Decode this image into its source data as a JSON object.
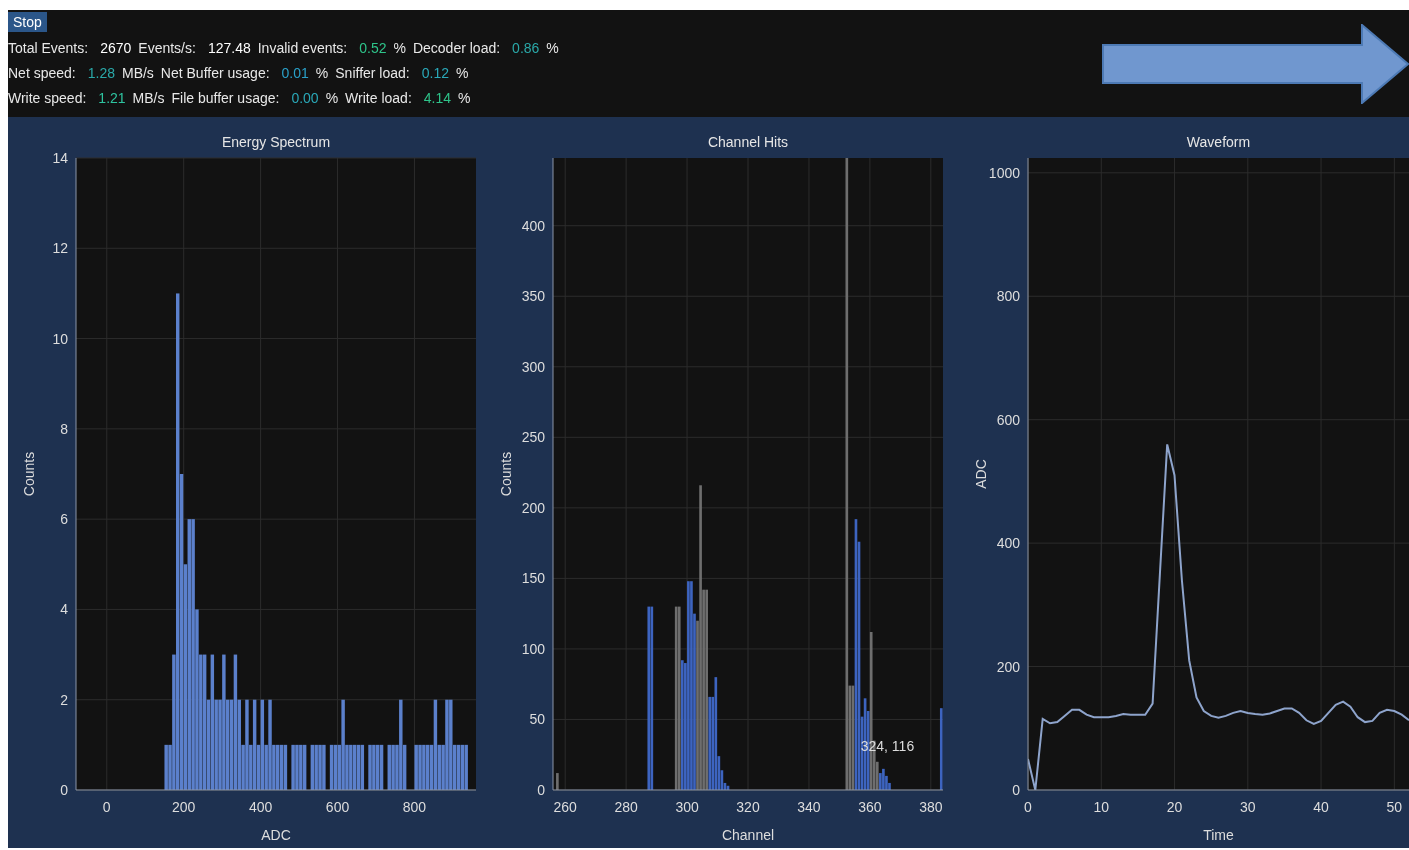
{
  "stop_button": {
    "label": "Stop"
  },
  "stats": [
    [
      {
        "label": "Total Events:",
        "value": "2670",
        "color": "#ffffff"
      },
      {
        "label": "Events/s:",
        "value": "127.48",
        "color": "#ffffff"
      },
      {
        "label": "Invalid events:",
        "value": "0.52",
        "unit": "%",
        "color": "#2ec48a"
      },
      {
        "label": "Decoder load:",
        "value": "0.86",
        "unit": "%",
        "color": "#2aa8a8"
      }
    ],
    [
      {
        "label": "Net speed:",
        "value": "1.28",
        "unit": "MB/s",
        "color": "#2aa8a8"
      },
      {
        "label": "Net Buffer usage:",
        "value": "0.01",
        "unit": "%",
        "color": "#2aa0c8"
      },
      {
        "label": "Sniffer load:",
        "value": "0.12",
        "unit": "%",
        "color": "#2aa8b8"
      }
    ],
    [
      {
        "label": "Write speed:",
        "value": "1.21",
        "unit": "MB/s",
        "color": "#2ec4a0"
      },
      {
        "label": "File buffer usage:",
        "value": "0.00",
        "unit": "%",
        "color": "#2aa8b8"
      },
      {
        "label": "Write load:",
        "value": "4.14",
        "unit": "%",
        "color": "#2ec48a"
      }
    ]
  ],
  "plots": [
    {
      "chart_data": {
        "type": "bar",
        "title": "Energy Spectrum",
        "xlabel": "ADC",
        "ylabel": "Counts",
        "grid": true,
        "xlim": [
          -80,
          960
        ],
        "ylim": [
          0,
          14
        ],
        "xticks": [
          0,
          200,
          400,
          600,
          800
        ],
        "yticks": [
          0,
          2,
          4,
          6,
          8,
          10,
          12,
          14
        ],
        "x": [
          150,
          160,
          170,
          180,
          190,
          200,
          210,
          220,
          230,
          240,
          250,
          260,
          270,
          280,
          290,
          300,
          310,
          320,
          330,
          340,
          350,
          360,
          370,
          380,
          390,
          400,
          410,
          420,
          430,
          440,
          450,
          460,
          470,
          480,
          490,
          500,
          510,
          520,
          530,
          540,
          550,
          560,
          570,
          580,
          590,
          600,
          610,
          620,
          630,
          640,
          650,
          660,
          670,
          680,
          690,
          700,
          710,
          720,
          730,
          740,
          750,
          760,
          770,
          780,
          790,
          800,
          810,
          820,
          830,
          840,
          850,
          860,
          870,
          880,
          890,
          900,
          910,
          920,
          930
        ],
        "series": [
          {
            "color": "#5b80cc",
            "values": [
              1,
              1,
              3,
              11,
              7,
              5,
              6,
              6,
              4,
              3,
              3,
              2,
              3,
              2,
              2,
              3,
              2,
              2,
              3,
              2,
              1,
              2,
              1,
              2,
              1,
              2,
              1,
              2,
              1,
              1,
              1,
              1,
              0,
              1,
              1,
              1,
              1,
              0,
              1,
              1,
              1,
              1,
              0,
              1,
              1,
              1,
              2,
              1,
              1,
              1,
              1,
              1,
              0,
              1,
              1,
              1,
              1,
              0,
              1,
              1,
              1,
              2,
              1,
              0,
              0,
              1,
              1,
              1,
              1,
              1,
              2,
              1,
              1,
              2,
              2,
              1,
              1,
              1,
              1
            ]
          }
        ]
      }
    },
    {
      "chart_data": {
        "type": "bar",
        "title": "Channel Hits",
        "xlabel": "Channel",
        "ylabel": "Counts",
        "grid": true,
        "xlim": [
          256,
          384
        ],
        "ylim": [
          0,
          448
        ],
        "xticks": [
          260,
          280,
          300,
          320,
          340,
          360,
          380
        ],
        "yticks": [
          0,
          50,
          100,
          150,
          200,
          250,
          300,
          350,
          400
        ],
        "x": [
          257,
          287,
          288,
          296,
          297,
          298,
          299,
          300,
          301,
          302,
          303,
          304,
          305,
          306,
          307,
          308,
          309,
          310,
          311,
          312,
          313,
          352,
          353,
          354,
          355,
          356,
          357,
          358,
          359,
          360,
          361,
          362,
          363,
          364,
          365,
          366,
          383
        ],
        "series": [
          {
            "color": "#3d64c0",
            "values": [
              null,
              130,
              130,
              null,
              null,
              92,
              90,
              148,
              148,
              125,
              null,
              null,
              null,
              null,
              66,
              66,
              80,
              24,
              14,
              5,
              3,
              null,
              null,
              null,
              192,
              176,
              52,
              65,
              56,
              null,
              null,
              null,
              12,
              15,
              10,
              5,
              58
            ]
          },
          {
            "color": "#6e6e6e",
            "values": [
              12,
              null,
              null,
              130,
              130,
              null,
              null,
              null,
              null,
              null,
              120,
              216,
              142,
              142,
              null,
              null,
              null,
              null,
              null,
              null,
              null,
              448,
              74,
              74,
              null,
              null,
              null,
              null,
              null,
              112,
              35,
              20,
              null,
              null,
              null,
              null,
              null
            ]
          }
        ],
        "annotations": [
          {
            "text": "324, 116",
            "x": 357,
            "y": 12
          }
        ]
      }
    },
    {
      "chart_data": {
        "type": "line",
        "title": "Waveform",
        "xlabel": "Time",
        "ylabel": "ADC",
        "grid": true,
        "xlim": [
          0,
          52
        ],
        "ylim": [
          0,
          1024
        ],
        "xticks": [
          0,
          10,
          20,
          30,
          40,
          50
        ],
        "yticks": [
          0,
          200,
          400,
          600,
          800,
          1000
        ],
        "x": [
          0,
          1,
          2,
          3,
          4,
          5,
          6,
          7,
          8,
          9,
          10,
          11,
          12,
          13,
          14,
          15,
          16,
          17,
          18,
          19,
          20,
          21,
          22,
          23,
          24,
          25,
          26,
          27,
          28,
          29,
          30,
          31,
          32,
          33,
          34,
          35,
          36,
          37,
          38,
          39,
          40,
          41,
          42,
          43,
          44,
          45,
          46,
          47,
          48,
          49,
          50,
          51,
          52
        ],
        "series": [
          {
            "color": "#8ea4cc",
            "values": [
              50,
              0,
              115,
              108,
              110,
              120,
              130,
              130,
              122,
              118,
              118,
              118,
              120,
              123,
              122,
              122,
              122,
              140,
              350,
              560,
              510,
              340,
              210,
              150,
              128,
              120,
              117,
              120,
              125,
              128,
              125,
              123,
              122,
              124,
              128,
              132,
              132,
              125,
              113,
              107,
              112,
              125,
              138,
              143,
              135,
              118,
              110,
              112,
              125,
              130,
              128,
              122,
              113
            ]
          }
        ]
      }
    }
  ]
}
